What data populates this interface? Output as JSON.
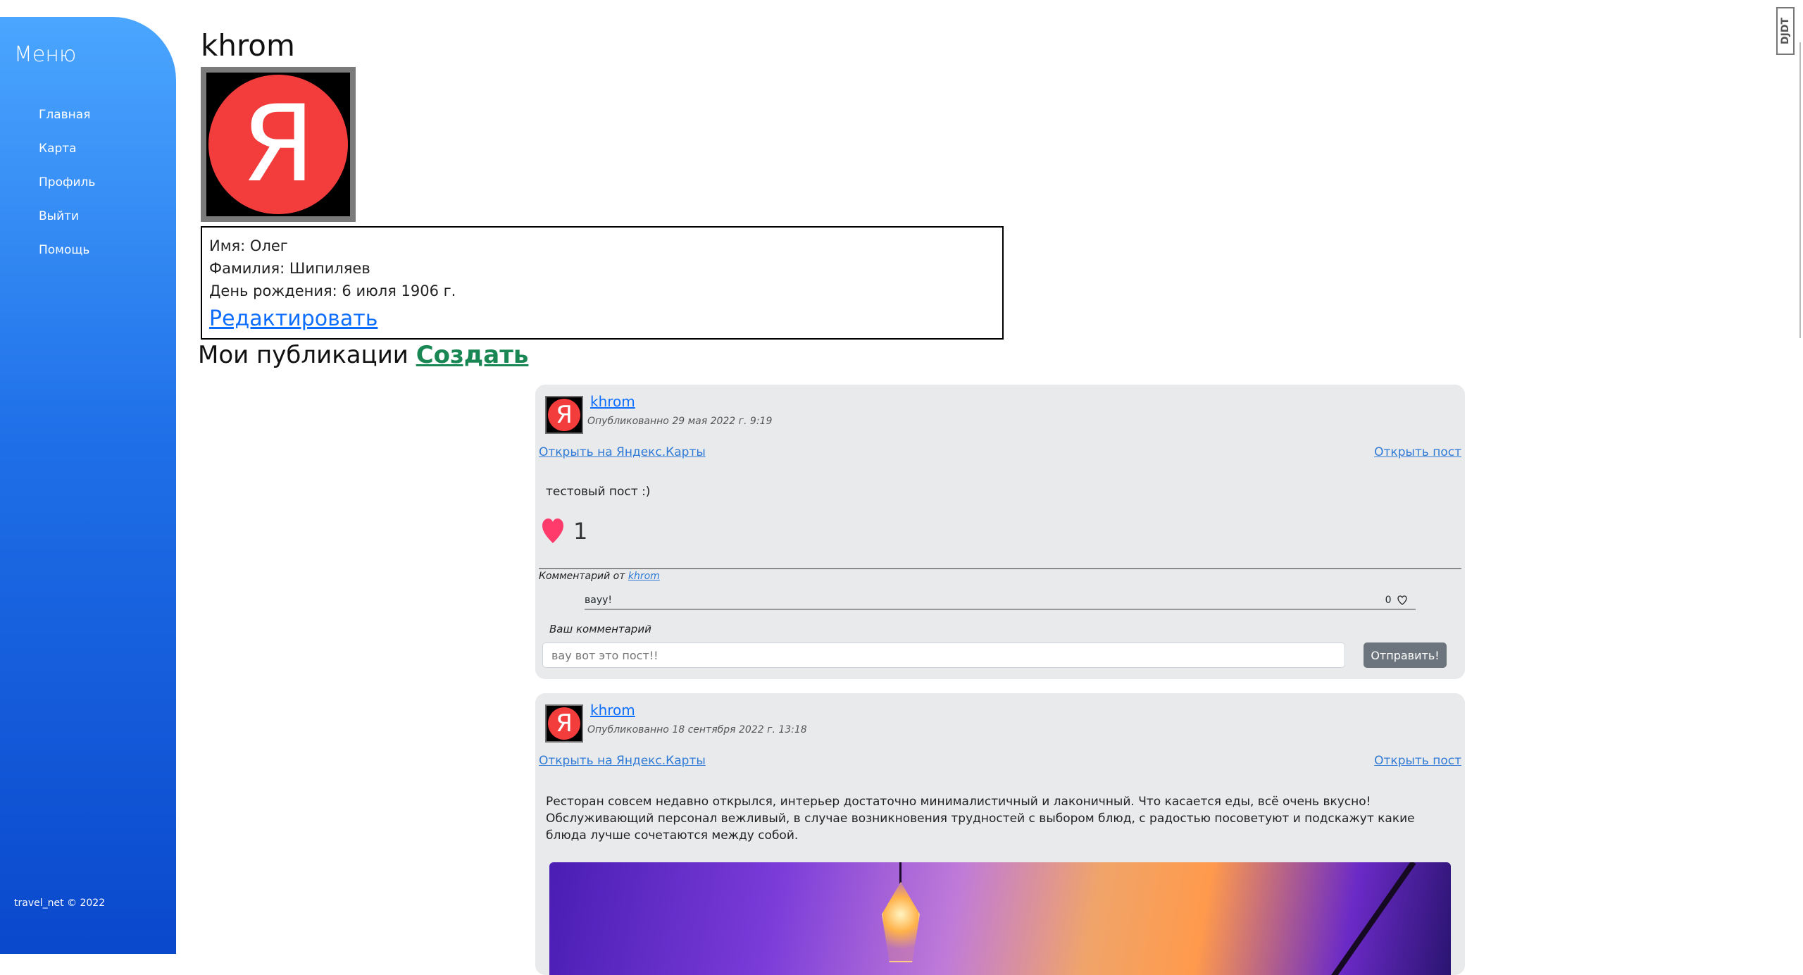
{
  "sidebar": {
    "title": "Меню",
    "items": [
      {
        "label": "Главная"
      },
      {
        "label": "Карта"
      },
      {
        "label": "Профиль"
      },
      {
        "label": "Выйти"
      },
      {
        "label": "Помощь"
      }
    ],
    "copyright": "travel_net © 2022"
  },
  "profile": {
    "username": "khrom",
    "avatar_letter": "Я",
    "first_name": "Имя: Олег",
    "last_name": "Фамилия: Шипиляев",
    "birthday": "День рождения: 6 июля 1906 г.",
    "edit_label": "Редактировать"
  },
  "publications": {
    "title": "Мои публикации",
    "create_label": "Создать"
  },
  "posts": [
    {
      "avatar_letter": "Я",
      "author": "khrom",
      "date": "Опубликованно 29 мая 2022 г. 9:19",
      "map_link": "Открыть на Яндекс.Карты",
      "open_link": "Открыть пост",
      "text": "тестовый пост :)",
      "likes": "1",
      "comment_header": "Комментарий от",
      "comment_author": "khrom",
      "comment_text": "вауу!",
      "comment_likes": "0",
      "your_comment_label": "Ваш комментарий",
      "comment_placeholder": "вау вот это пост!!",
      "send_label": "Отправить!"
    },
    {
      "avatar_letter": "Я",
      "author": "khrom",
      "date": "Опубликованно 18 сентября 2022 г. 13:18",
      "map_link": "Открыть на Яндекс.Карты",
      "open_link": "Открыть пост",
      "text": "Ресторан совсем недавно открылся, интерьер достаточно минималистичный и лаконичный. Что касается еды, всё очень вкусно! Обслуживающий персонал вежливый, в случае возникновения трудностей с выбором блюд, с радостью посоветуют и подскажут какие блюда лучше сочетаются между собой."
    }
  ],
  "extension_badge": "DJDT",
  "colors": {
    "sidebar_top": "#4aa6ff",
    "sidebar_bottom": "#0a48cc",
    "link": "#0d6efd",
    "create": "#198754",
    "heart": "#ff3b6b",
    "card_bg": "#e9eaec"
  }
}
